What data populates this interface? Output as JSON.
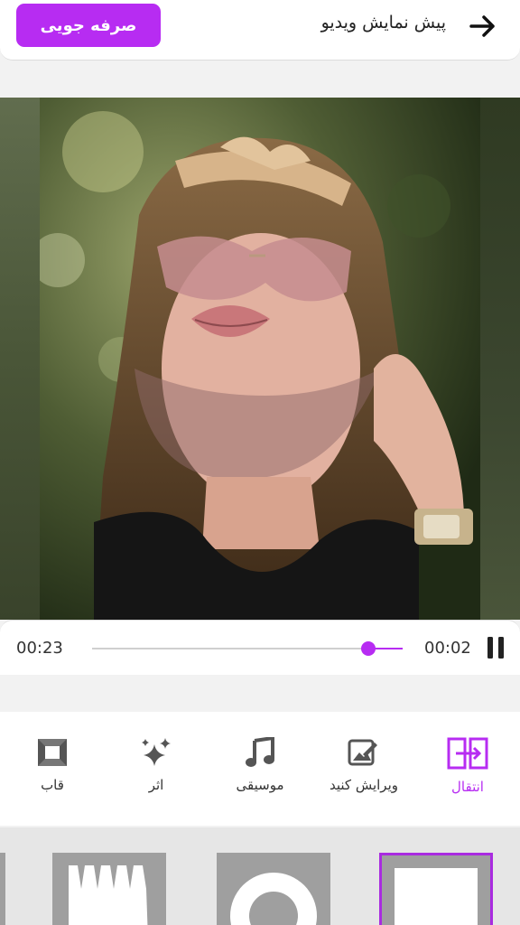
{
  "header": {
    "title": "پیش نمایش ویدیو",
    "save_label": "صرفه جویی",
    "back_icon": "arrow-right-icon"
  },
  "player": {
    "total_time": "00:23",
    "current_time": "00:02",
    "progress": 0.11,
    "pause_icon": "pause-icon"
  },
  "toolbar": {
    "items": [
      {
        "label": "انتقال",
        "icon": "transition-icon",
        "active": true
      },
      {
        "label": "ویرایش کنید",
        "icon": "edit-image-icon",
        "active": false
      },
      {
        "label": "موسیقی",
        "icon": "music-icon",
        "active": false
      },
      {
        "label": "اثر",
        "icon": "sparkle-icon",
        "active": false
      },
      {
        "label": "قاب",
        "icon": "frame-icon",
        "active": false
      }
    ]
  },
  "colors": {
    "accent": "#b72cf2",
    "header_bg": "#ffffff",
    "strip_bg": "#e6e6e6"
  }
}
